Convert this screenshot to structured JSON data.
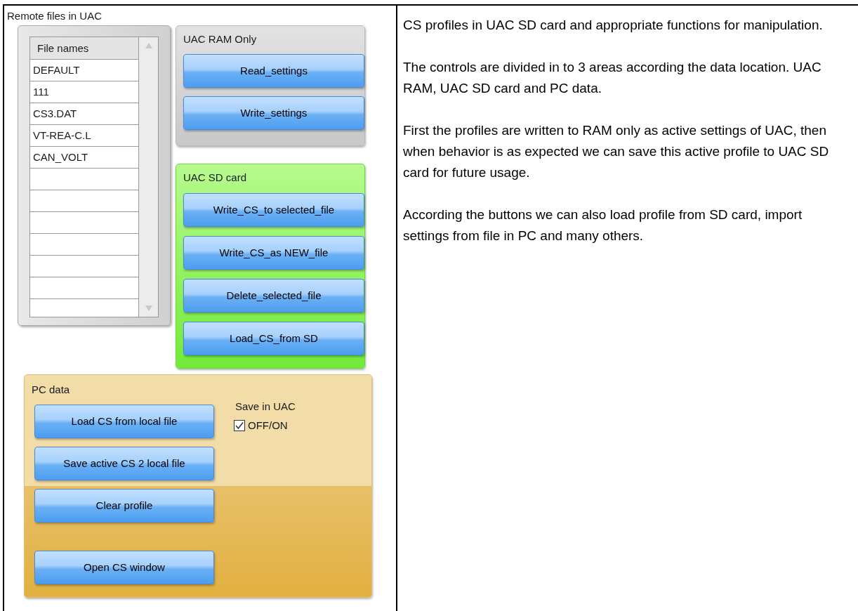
{
  "panel": {
    "remote_files": {
      "title": "Remote files in UAC",
      "list": {
        "header": "File names",
        "rows": [
          "DEFAULT",
          "111",
          "CS3.DAT",
          "VT-REA-C.L",
          "CAN_VOLT"
        ]
      }
    },
    "ram": {
      "title": "UAC RAM Only",
      "buttons": [
        "Read_settings",
        "Write_settings"
      ]
    },
    "sd": {
      "title": "UAC SD card",
      "buttons": [
        "Write_CS_to selected_file",
        "Write_CS_as NEW_file",
        "Delete_selected_file",
        "Load_CS_from SD"
      ]
    },
    "pc": {
      "title": "PC data",
      "buttons": [
        "Load CS from local file",
        "Save active CS 2 local file",
        "Clear profile",
        "Open CS window"
      ],
      "save": {
        "title": "Save in UAC",
        "checkbox": {
          "label": "OFF/ON",
          "checked": true
        }
      }
    }
  },
  "description": [
    "CS profiles in UAC SD card and appropriate functions for manipulation.",
    "The controls are divided in to 3 areas according the data location. UAC RAM, UAC SD card and PC data.",
    "First the profiles are written to RAM only as active settings of UAC, then when behavior is as expected we can save this active profile to UAC SD card for future usage.",
    "According the buttons we can also load profile from SD card, import settings from file in PC and many others."
  ]
}
